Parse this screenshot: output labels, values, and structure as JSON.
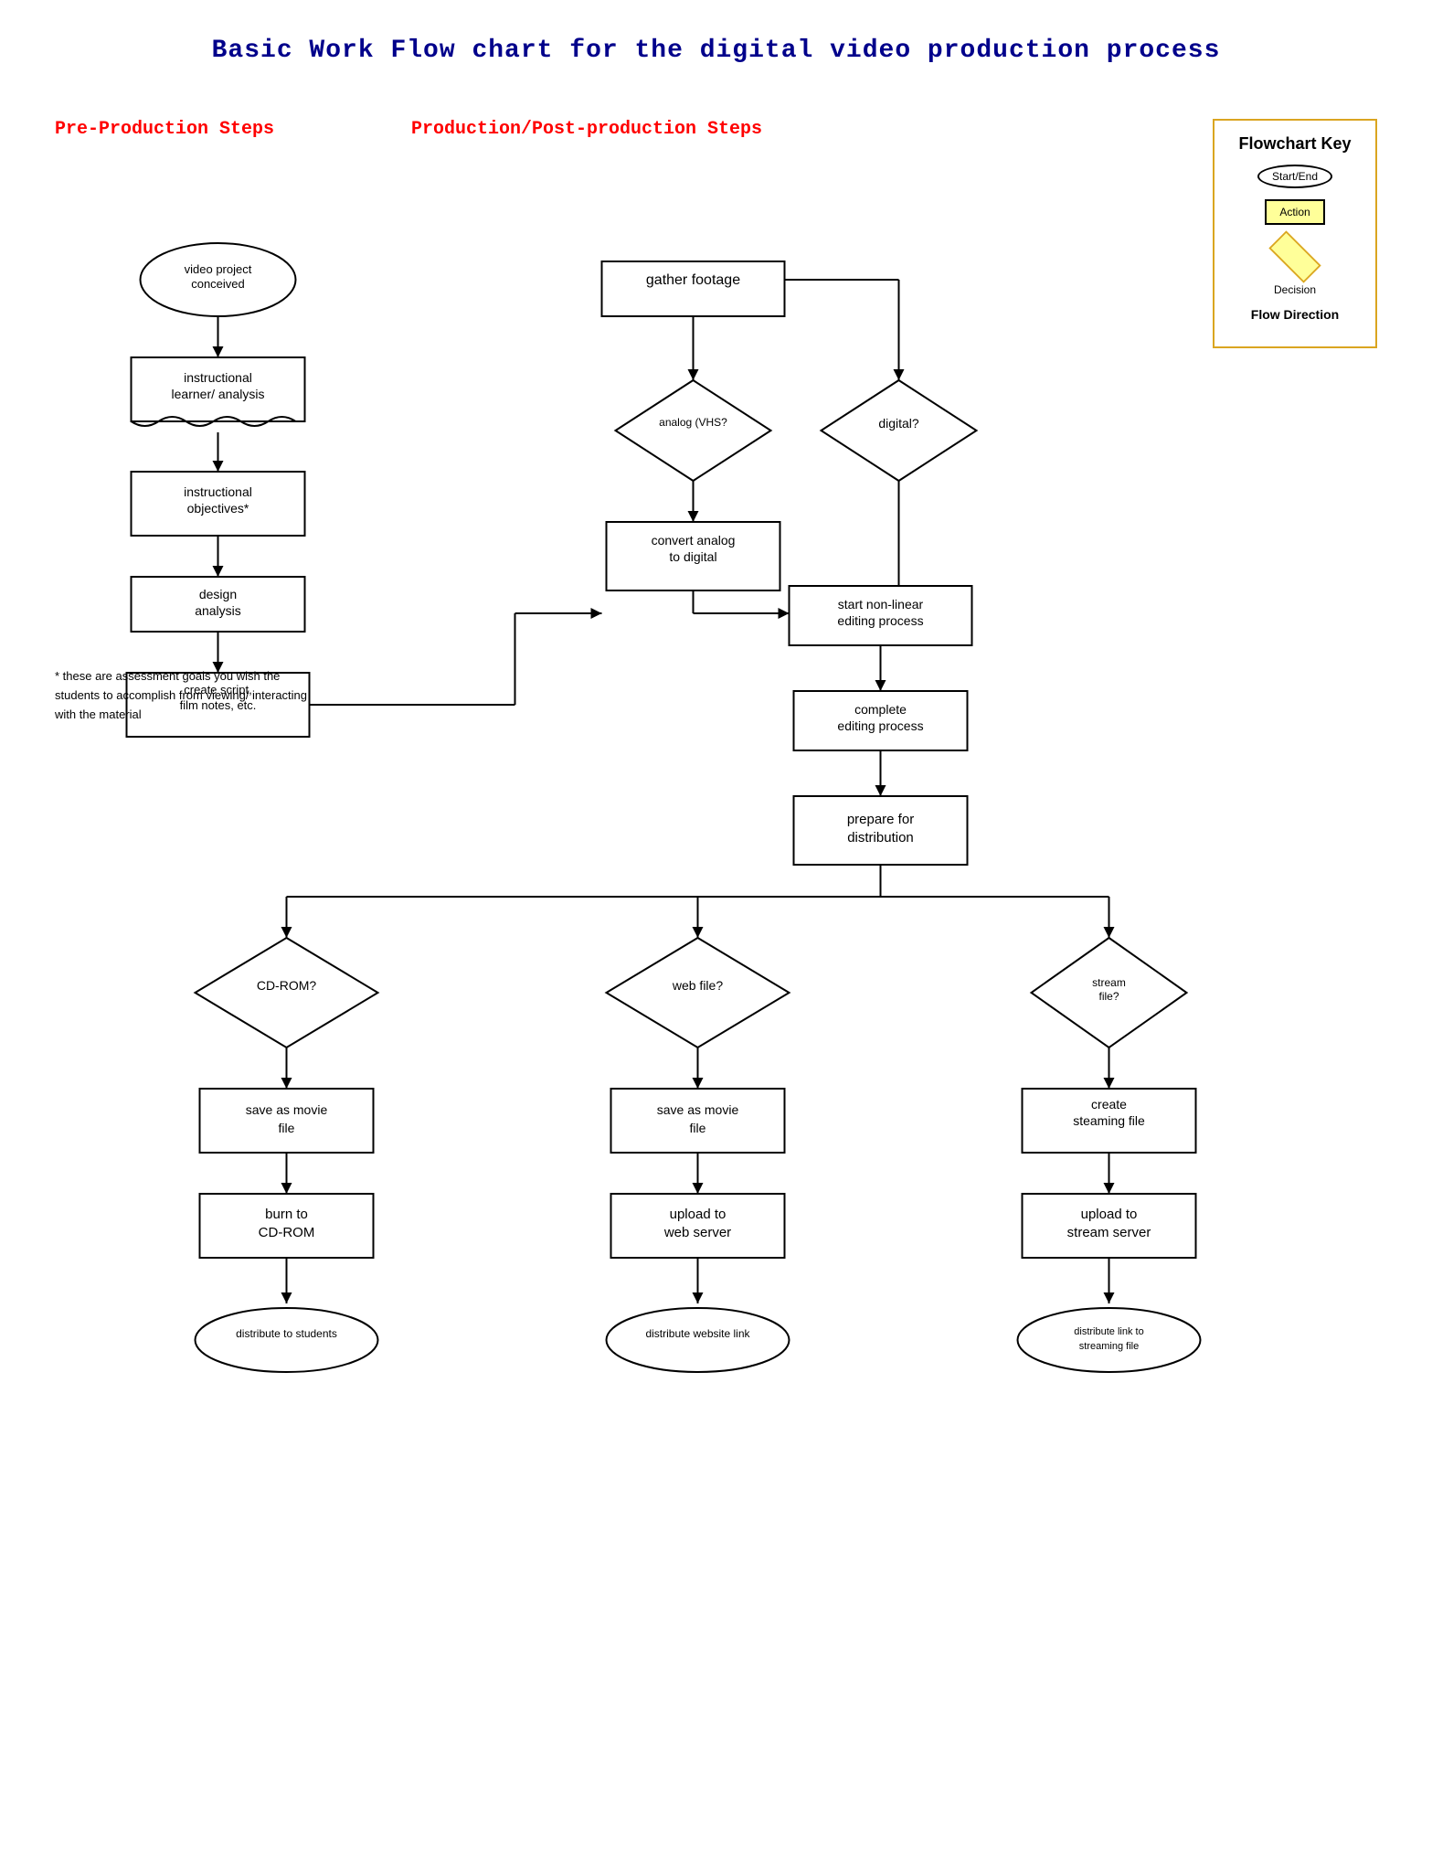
{
  "title": "Basic Work Flow chart for the digital video production process",
  "sections": {
    "pre_production": "Pre-Production Steps",
    "production": "Production/Post-production Steps"
  },
  "key": {
    "title": "Flowchart Key",
    "start_end": "Start/End",
    "action": "Action",
    "decision": "Decision",
    "flow": "Flow Direction"
  },
  "nodes": {
    "video_project": "video project conceived",
    "instructional_learner": "instructional learner/ analysis",
    "instructional_objectives": "instructional objectives*",
    "design_analysis": "design analysis",
    "create_script": "create script, film notes, etc.",
    "gather_footage": "gather footage",
    "analog": "analog (VHS?",
    "digital": "digital?",
    "convert_analog": "convert analog to digital",
    "non_linear": "start non-linear editing process",
    "complete_editing": "complete editing process",
    "prepare_distribution": "prepare for distribution",
    "cd_rom_q": "CD-ROM?",
    "web_file_q": "web file?",
    "stream_file_q": "stream file?",
    "save_movie_cd": "save as movie file",
    "save_movie_web": "save as movie file",
    "create_streaming": "create steaming file",
    "burn_cd": "burn to CD-ROM",
    "upload_web": "upload to web server",
    "upload_stream": "upload to stream server",
    "distribute_students": "distribute to students",
    "distribute_web": "distribute website link",
    "distribute_streaming": "distribute link to streaming file"
  },
  "footnote": "* these are assessment goals you wish the students to accomplish from viewing/ interacting with the material"
}
